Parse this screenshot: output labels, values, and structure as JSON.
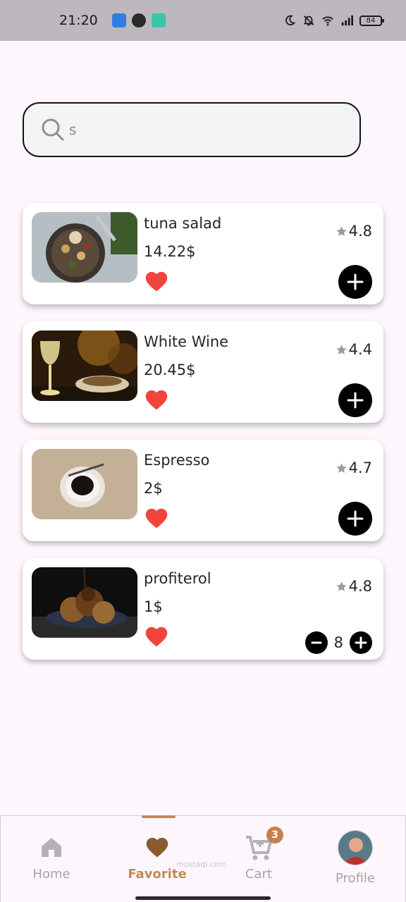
{
  "status_bar": {
    "time": "21:20",
    "battery": "84",
    "icons": [
      "app-notification-icon",
      "app-notification-icon",
      "app-notification-icon",
      "moon-icon",
      "bell-off-icon",
      "wifi-icon",
      "signal-icon",
      "battery-icon"
    ]
  },
  "search": {
    "value": "s",
    "icon": "search-icon"
  },
  "items": [
    {
      "name": "tuna salad",
      "price": "14.22$",
      "rating": "4.8",
      "favorite": true,
      "control": "add"
    },
    {
      "name": "White Wine",
      "price": "20.45$",
      "rating": "4.4",
      "favorite": true,
      "control": "add"
    },
    {
      "name": "Espresso",
      "price": "2$",
      "rating": "4.7",
      "favorite": true,
      "control": "add"
    },
    {
      "name": "profiterol",
      "price": "1$",
      "rating": "4.8",
      "favorite": true,
      "control": "stepper",
      "quantity": "8"
    }
  ],
  "nav": {
    "home": "Home",
    "favorite": "Favorite",
    "cart": "Cart",
    "cart_badge": "3",
    "profile": "Profile",
    "active": "favorite"
  },
  "watermark": "mostaql.com",
  "colors": {
    "accent": "#c08a5a",
    "heart": "#f0443c",
    "background": "#fdf7fd",
    "badge": "#c8804a"
  }
}
